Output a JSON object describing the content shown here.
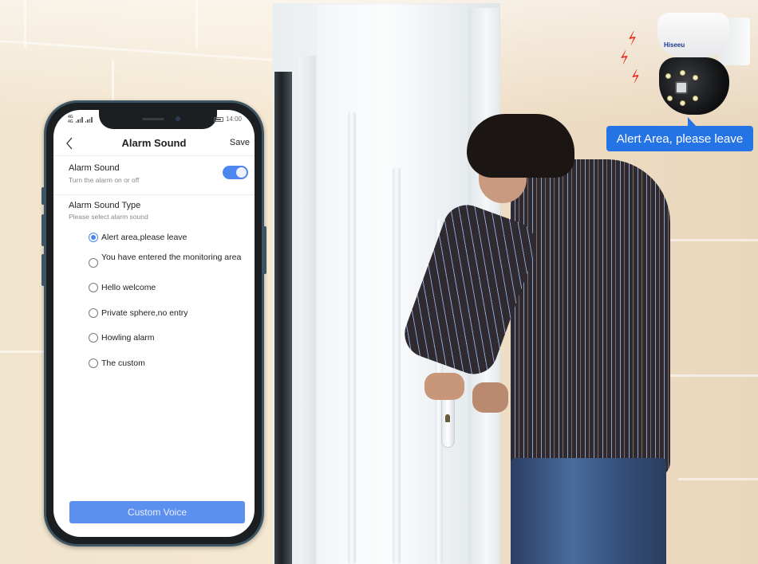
{
  "status_bar": {
    "network_labels": [
      "4G",
      "4G"
    ],
    "time": "14:00"
  },
  "app": {
    "nav": {
      "back_icon": "chevron-left-icon",
      "title": "Alarm Sound",
      "save_label": "Save"
    },
    "alarm_toggle": {
      "title": "Alarm Sound",
      "subtitle": "Turn the alarm on or off",
      "enabled": true
    },
    "sound_type": {
      "title": "Alarm Sound Type",
      "subtitle": "Please select alarm sound",
      "options": [
        {
          "label": "Alert area,please leave",
          "selected": true
        },
        {
          "label": "You have entered the monitoring area",
          "selected": false
        },
        {
          "label": "Hello welcome",
          "selected": false
        },
        {
          "label": "Private sphere,no entry",
          "selected": false
        },
        {
          "label": "Howling alarm",
          "selected": false
        },
        {
          "label": "The custom",
          "selected": false
        }
      ],
      "selected_value": "Alert area,please leave"
    },
    "custom_voice_button": "Custom Voice"
  },
  "camera": {
    "brand_logo": "Hiseeu",
    "alert_icon": "lightning-bolt-icon"
  },
  "callout": {
    "text": "Alert Area, please leave"
  },
  "colors": {
    "accent_blue": "#4d86ee",
    "button_blue": "#5b8ff0",
    "callout_blue": "#2574e6",
    "alert_red": "#e8241e",
    "phone_frame": "#3d5563"
  }
}
